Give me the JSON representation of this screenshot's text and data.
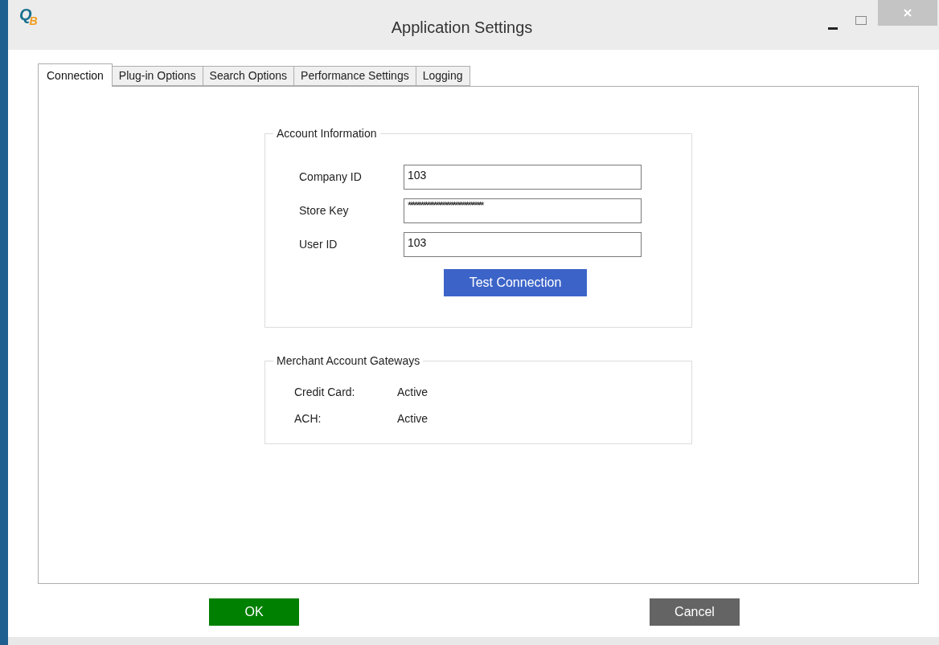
{
  "window": {
    "title": "Application Settings",
    "logo": [
      "Q",
      "B"
    ]
  },
  "tabs": [
    {
      "label": "Connection",
      "selected": true
    },
    {
      "label": "Plug-in Options",
      "selected": false
    },
    {
      "label": "Search Options",
      "selected": false
    },
    {
      "label": "Performance Settings",
      "selected": false
    },
    {
      "label": "Logging",
      "selected": false
    }
  ],
  "account_information": {
    "title": "Account Information",
    "fields": [
      {
        "label": "Company ID",
        "value": "103",
        "kind": "text"
      },
      {
        "label": "Store Key",
        "value": "***********************************",
        "kind": "password"
      },
      {
        "label": "User ID",
        "value": "103",
        "kind": "text"
      }
    ],
    "button": "Test Connection"
  },
  "merchant_account_gateways": {
    "title": "Merchant Account Gateways",
    "rows": [
      {
        "label": "Credit Card:",
        "value": "Active"
      },
      {
        "label": "ACH:",
        "value": "Active"
      }
    ]
  },
  "buttons": [
    {
      "label": "OK",
      "kind": "primary"
    },
    {
      "label": "Cancel",
      "kind": "secondary"
    }
  ]
}
